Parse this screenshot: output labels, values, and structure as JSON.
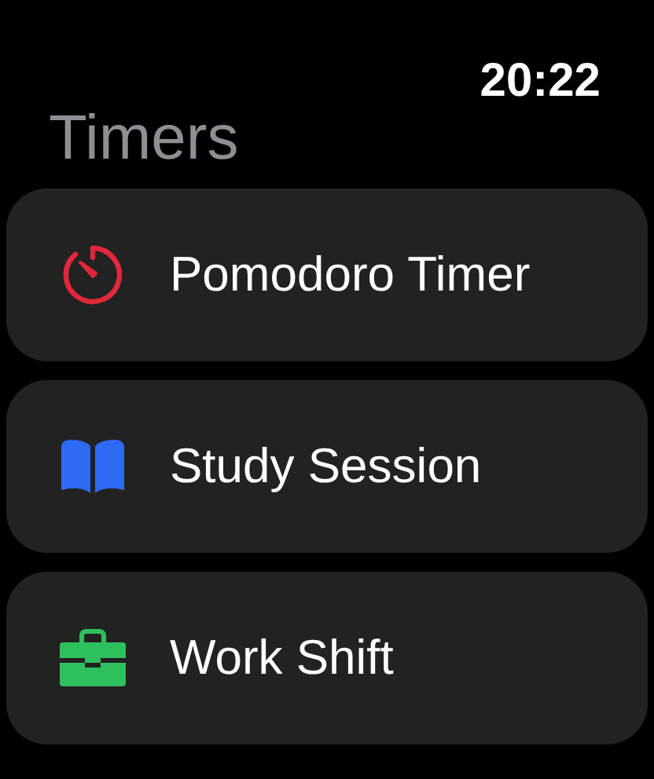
{
  "status_bar": {
    "time": "20:22"
  },
  "title": "Timers",
  "timers": [
    {
      "label": "Pomodoro Timer",
      "kind": "timer",
      "color": "#e0283a"
    },
    {
      "label": "Study Session",
      "kind": "book",
      "color": "#2f6af5"
    },
    {
      "label": "Work Shift",
      "kind": "briefcase",
      "color": "#2ec05c"
    }
  ]
}
